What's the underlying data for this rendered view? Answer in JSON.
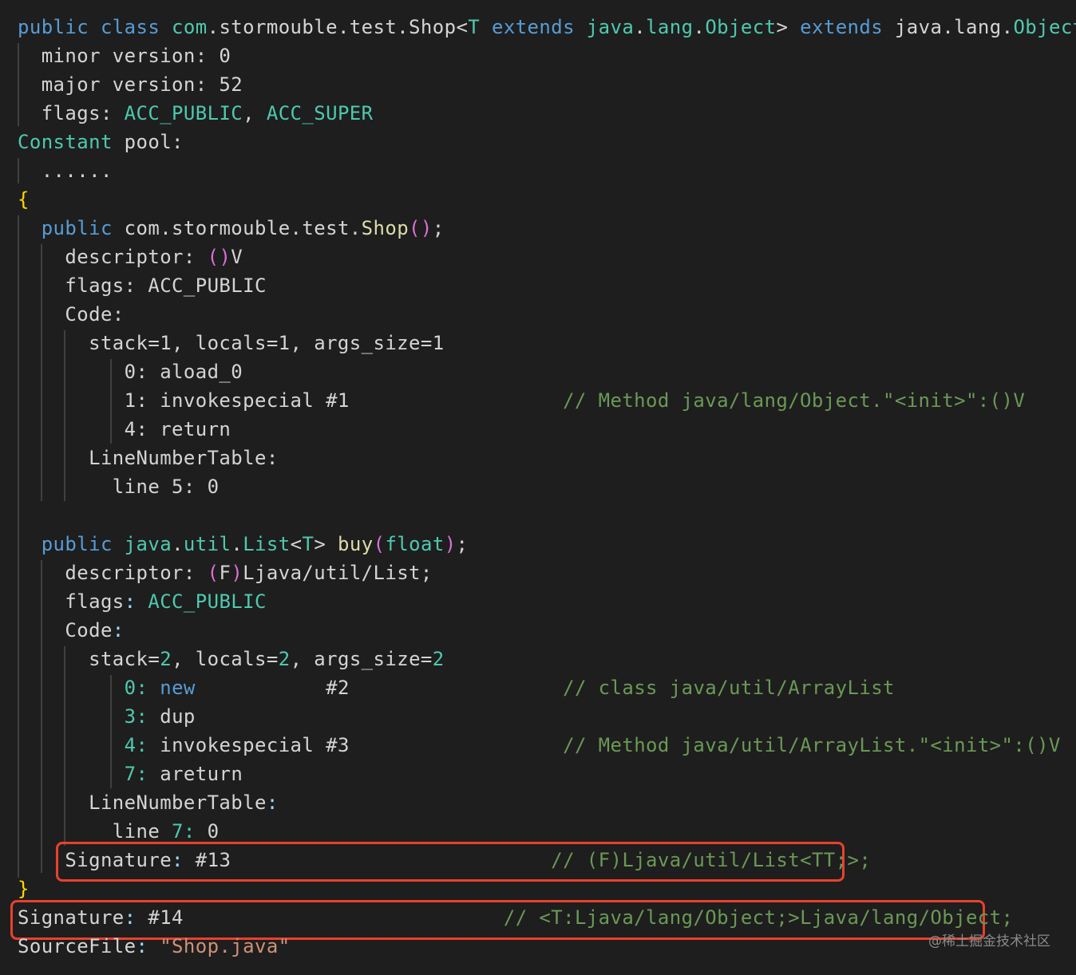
{
  "code_lines": [
    [
      [
        "public class ",
        "kw"
      ],
      [
        "com",
        "ty"
      ],
      [
        ".stormouble.test.Shop<",
        "tx"
      ],
      [
        "T ",
        "ty"
      ],
      [
        "extends ",
        "kw"
      ],
      [
        "java",
        "ty"
      ],
      [
        ".",
        "tx"
      ],
      [
        "lang",
        "ty"
      ],
      [
        ".",
        "tx"
      ],
      [
        "Object",
        "ty"
      ],
      [
        "> ",
        "tx"
      ],
      [
        "extends ",
        "kw"
      ],
      [
        "java.lang.",
        "tx"
      ],
      [
        "Object",
        "ty"
      ]
    ],
    [
      [
        "  minor version: 0",
        "tx"
      ]
    ],
    [
      [
        "  major version: 52",
        "tx"
      ]
    ],
    [
      [
        "  flags: ",
        "tx"
      ],
      [
        "ACC_PUBLIC",
        "ty"
      ],
      [
        ", ",
        "tx"
      ],
      [
        "ACC_SUPER",
        "ty"
      ]
    ],
    [
      [
        "Constant ",
        "ty"
      ],
      [
        "pool:",
        "tx"
      ]
    ],
    [
      [
        "  ......",
        "tx"
      ]
    ],
    [
      [
        "{",
        "br"
      ]
    ],
    [
      [
        "  ",
        "tx"
      ],
      [
        "public ",
        "kw"
      ],
      [
        "com.stormouble.test.",
        "tx"
      ],
      [
        "Shop",
        "fn"
      ],
      [
        "()",
        "pa"
      ],
      [
        ";",
        "tx"
      ]
    ],
    [
      [
        "    descriptor: ",
        "tx"
      ],
      [
        "()",
        "pa"
      ],
      [
        "V",
        "tx"
      ]
    ],
    [
      [
        "    flags: ACC_PUBLIC",
        "tx"
      ]
    ],
    [
      [
        "    Code:",
        "tx"
      ]
    ],
    [
      [
        "      stack=1, locals=1, args_size=1",
        "tx"
      ]
    ],
    [
      [
        "         0: aload_0",
        "tx"
      ]
    ],
    [
      [
        "         1: invokespecial #1                  ",
        "tx"
      ],
      [
        "// Method java/lang/Object.\"<init>\":()V",
        "cm"
      ]
    ],
    [
      [
        "         4: return",
        "tx"
      ]
    ],
    [
      [
        "      LineNumberTable:",
        "tx"
      ]
    ],
    [
      [
        "        line 5: 0",
        "tx"
      ]
    ],
    [
      [
        "",
        "tx"
      ]
    ],
    [
      [
        "  ",
        "tx"
      ],
      [
        "public ",
        "kw"
      ],
      [
        "java",
        "ty"
      ],
      [
        ".",
        "tx"
      ],
      [
        "util",
        "ty"
      ],
      [
        ".",
        "tx"
      ],
      [
        "List",
        "ty"
      ],
      [
        "<",
        "tx"
      ],
      [
        "T",
        "ty"
      ],
      [
        "> ",
        "tx"
      ],
      [
        "buy",
        "fn"
      ],
      [
        "(",
        "pa"
      ],
      [
        "float",
        "ty"
      ],
      [
        ")",
        "pa"
      ],
      [
        ";",
        "tx"
      ]
    ],
    [
      [
        "    descriptor: ",
        "tx"
      ],
      [
        "(",
        "pa"
      ],
      [
        "F",
        "tx"
      ],
      [
        ")",
        "pa"
      ],
      [
        "Ljava/util/List;",
        "tx"
      ]
    ],
    [
      [
        "    flags",
        "tx"
      ],
      [
        ": ",
        "vr"
      ],
      [
        "ACC_PUBLIC",
        "ty"
      ]
    ],
    [
      [
        "    Code",
        "tx"
      ],
      [
        ":",
        "vr"
      ]
    ],
    [
      [
        "      stack=",
        "tx"
      ],
      [
        "2",
        "ty"
      ],
      [
        ", locals=",
        "tx"
      ],
      [
        "2",
        "ty"
      ],
      [
        ", args_size=",
        "tx"
      ],
      [
        "2",
        "ty"
      ]
    ],
    [
      [
        "         ",
        "tx"
      ],
      [
        "0: ",
        "ty"
      ],
      [
        "new",
        "kw"
      ],
      [
        "           #2                  ",
        "tx"
      ],
      [
        "// class java/util/ArrayList",
        "cm"
      ]
    ],
    [
      [
        "         ",
        "tx"
      ],
      [
        "3: ",
        "ty"
      ],
      [
        "dup",
        "tx"
      ]
    ],
    [
      [
        "         ",
        "tx"
      ],
      [
        "4: ",
        "ty"
      ],
      [
        "invokespecial #3                  ",
        "tx"
      ],
      [
        "// Method java/util/ArrayList.\"<init>\":()V",
        "cm"
      ]
    ],
    [
      [
        "         ",
        "tx"
      ],
      [
        "7: ",
        "ty"
      ],
      [
        "areturn",
        "tx"
      ]
    ],
    [
      [
        "      LineNumberTable",
        "tx"
      ],
      [
        ":",
        "vr"
      ]
    ],
    [
      [
        "        line ",
        "tx"
      ],
      [
        "7: ",
        "ty"
      ],
      [
        "0",
        "tx"
      ]
    ],
    [
      [
        "    Signature",
        "tx"
      ],
      [
        ": ",
        "vr"
      ],
      [
        "#13                           ",
        "tx"
      ],
      [
        "// (F)Ljava/util/List<TT;>;",
        "cm"
      ]
    ],
    [
      [
        "}",
        "br"
      ]
    ],
    [
      [
        "Signature",
        "tx"
      ],
      [
        ": ",
        "vr"
      ],
      [
        "#14                           ",
        "tx"
      ],
      [
        "// <T:Ljava/lang/Object;>Ljava/lang/Object;",
        "cm"
      ]
    ],
    [
      [
        "SourceFile",
        "tx"
      ],
      [
        ": ",
        "vr"
      ],
      [
        "\"Shop.java\"",
        "st"
      ]
    ]
  ],
  "watermark": "@稀土掘金技术社区",
  "colors": {
    "background": "#1e1e1e",
    "keyword": "#569cd6",
    "type": "#4ec9b0",
    "function": "#dcdcaa",
    "comment": "#6a9955",
    "string": "#ce9178",
    "bracket": "#ffd700",
    "paren": "#da70d6",
    "highlight_box": "#e8412c"
  }
}
